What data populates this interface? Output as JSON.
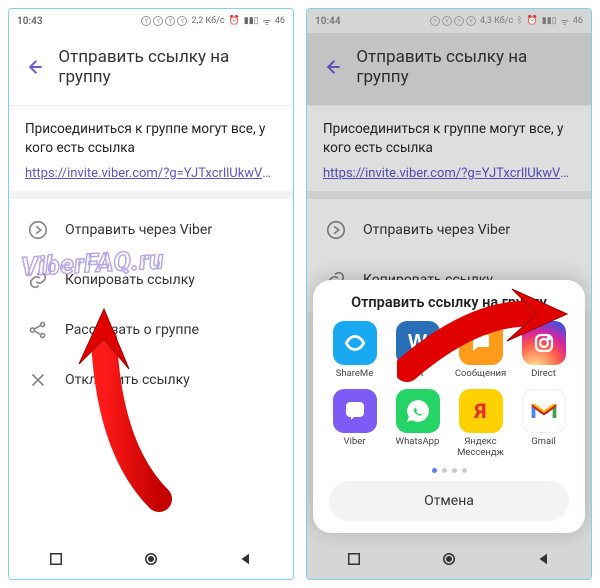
{
  "left": {
    "statusbar": {
      "time": "10:43",
      "net": "2,2 Кб/с",
      "batt": "46"
    },
    "header": {
      "title": "Отправить ссылку на группу"
    },
    "section": {
      "text": "Присоединиться к группе могут все, у кого есть ссылка",
      "link": "https://invite.viber.com/?g=YJTxcrllUkwVG..."
    },
    "options": {
      "send_viber": "Отправить через Viber",
      "copy_link": "Копировать ссылку",
      "share_group": "Рассказать о группе",
      "revoke_link": "Отключить ссылку"
    }
  },
  "right": {
    "statusbar": {
      "time": "10:44",
      "net": "4,3 Кб/с",
      "batt": "46"
    },
    "header": {
      "title": "Отправить ссылку на группу"
    },
    "section": {
      "text": "Присоединиться к группе могут все, у кого есть ссылка",
      "link": "https://invite.viber.com/?g=YJTxcrllUkwVG..."
    },
    "options": {
      "send_viber": "Отправить через Viber",
      "copy_link": "Копировать ссылку"
    },
    "sheet": {
      "title": "Отправить ссылку на группу",
      "apps": {
        "shareme": "ShareMe",
        "vk": "VK",
        "messages": "Сообщения",
        "direct": "Direct",
        "viber": "Viber",
        "whatsapp": "WhatsApp",
        "yandex": "Яндекс Мессендж",
        "gmail": "Gmail"
      },
      "cancel": "Отмена"
    }
  },
  "watermark": "ViberFAQ.ru"
}
